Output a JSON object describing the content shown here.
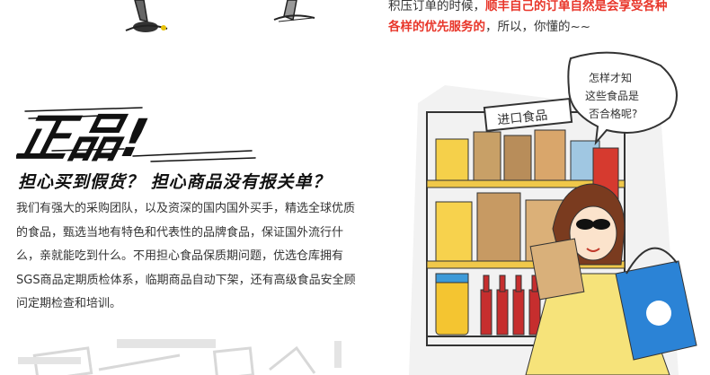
{
  "top_paragraph": {
    "line1_normal": "积压订单的时候，",
    "line1_red": "顺丰自己的订单自然是会享受各种",
    "line2_red": "各样的优先服务的",
    "line2_normal": "，所以，你懂的~~"
  },
  "title": {
    "art_text": "正品!"
  },
  "subtitle": "担心买到假货？ 担心商品没有报关单？",
  "body": {
    "paragraph": "我们有强大的采购团队，以及资深的国内国外买手，精选全球优质的食品，甄选当地有特色和代表性的品牌食品，保证国外流行什么，亲就能吃到什么。不用担心食品保质期问题，优选仓库拥有SGS商品定期质检体系，临期商品自动下架，还有高级食品安全顾问定期检查和培训。"
  },
  "illustration": {
    "shop_sign": "进口食品",
    "speech_line1": "怎样才知",
    "speech_line2": "这些食品是",
    "speech_line3": "否合格呢?"
  },
  "colors": {
    "accent_red": "#e8362a",
    "text": "#333333",
    "title_black": "#111111"
  }
}
